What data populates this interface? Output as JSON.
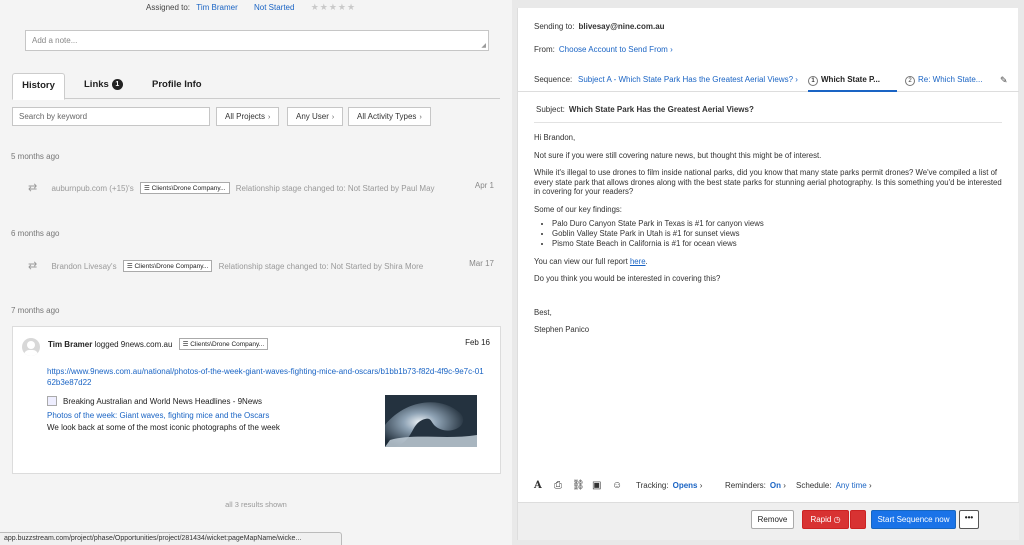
{
  "contact": {
    "assigned_label": "Assigned to:",
    "assigned_user": "Tim Bramer",
    "status": "Not Started",
    "rating_stars": "★★★★★",
    "note_placeholder": "Add a note..."
  },
  "tabs": {
    "history": "History",
    "links": "Links",
    "links_badge": "1",
    "profile": "Profile Info"
  },
  "filters": {
    "search_placeholder": "Search by keyword",
    "projects": "All Projects",
    "user": "Any User",
    "activity": "All Activity Types"
  },
  "history": {
    "groups": [
      {
        "ago": "5 months ago",
        "who": "auburnpub.com (+15)'s",
        "project": "Clients\\Drone Company...",
        "text": "Relationship stage changed to: Not Started by Paul May",
        "date": "Apr 1"
      },
      {
        "ago": "6 months ago",
        "who": "Brandon Livesay's",
        "project": "Clients\\Drone Company...",
        "text": "Relationship stage changed to: Not Started by Shira More",
        "date": "Mar 17"
      }
    ],
    "card": {
      "ago": "7 months ago",
      "author": "Tim Bramer",
      "action": "logged 9news.com.au",
      "project": "Clients\\Drone Company...",
      "date": "Feb 16",
      "url": "https://www.9news.com.au/national/photos-of-the-week-giant-waves-fighting-mice-and-oscars/b1bb1b73-f82d-4f9c-9e7c-0162b3e87d22",
      "site_name": "Breaking Australian and World News Headlines - 9News",
      "title": "Photos of the week: Giant waves, fighting mice and the Oscars",
      "description": "We look back at some of the most iconic photographs of the week"
    },
    "results": "all 3 results shown"
  },
  "status_bar": "app.buzzstream.com/project/phase/Opportunities/project/281434/wicket:pageMapName/wicke...",
  "email": {
    "sending_label": "Sending to:",
    "sending_to": "blivesay@nine.com.au",
    "from_label": "From:",
    "from_value": "Choose Account to Send From",
    "sequence_label": "Sequence:",
    "sequence_name": "Subject A - Which State Park Has the Greatest Aerial Views?",
    "steps": [
      {
        "num": "1",
        "label": "Which State P..."
      },
      {
        "num": "2",
        "label": "Re: Which State..."
      }
    ],
    "subject_label": "Subject:",
    "subject": "Which State Park Has the Greatest Aerial Views?",
    "greeting": "Hi Brandon,",
    "p1": "Not sure if you were still covering nature news, but thought this might be of interest.",
    "p2": "While it's illegal to use drones to film inside national parks, did you know that many state parks permit drones? We've compiled a list of every state park that allows drones along with the best state parks for stunning aerial photography. Is this something you'd be interested in covering for your readers?",
    "p3": "Some of our key findings:",
    "findings": [
      "Palo Duro Canyon State Park in Texas is #1 for canyon views",
      "Goblin Valley State Park in Utah is #1 for sunset views",
      "Pismo State Beach in California is #1 for ocean views"
    ],
    "report_prefix": "You can view our full report",
    "report_link": "here",
    "report_suffix": ".",
    "p5": "Do you think you would be interested in covering this?",
    "signoff": "Best,",
    "signature": "Stephen Panico",
    "toolbar": {
      "tracking_label": "Tracking:",
      "tracking_value": "Opens",
      "reminders_label": "Reminders:",
      "reminders_value": "On",
      "schedule_label": "Schedule:",
      "schedule_value": "Any time"
    },
    "buttons": {
      "remove": "Remove",
      "rapid": "Rapid",
      "start": "Start Sequence now",
      "more": "•••"
    }
  },
  "colors": {
    "link": "#1a64c4",
    "rapid": "#d83232",
    "primary": "#1a73e8"
  }
}
